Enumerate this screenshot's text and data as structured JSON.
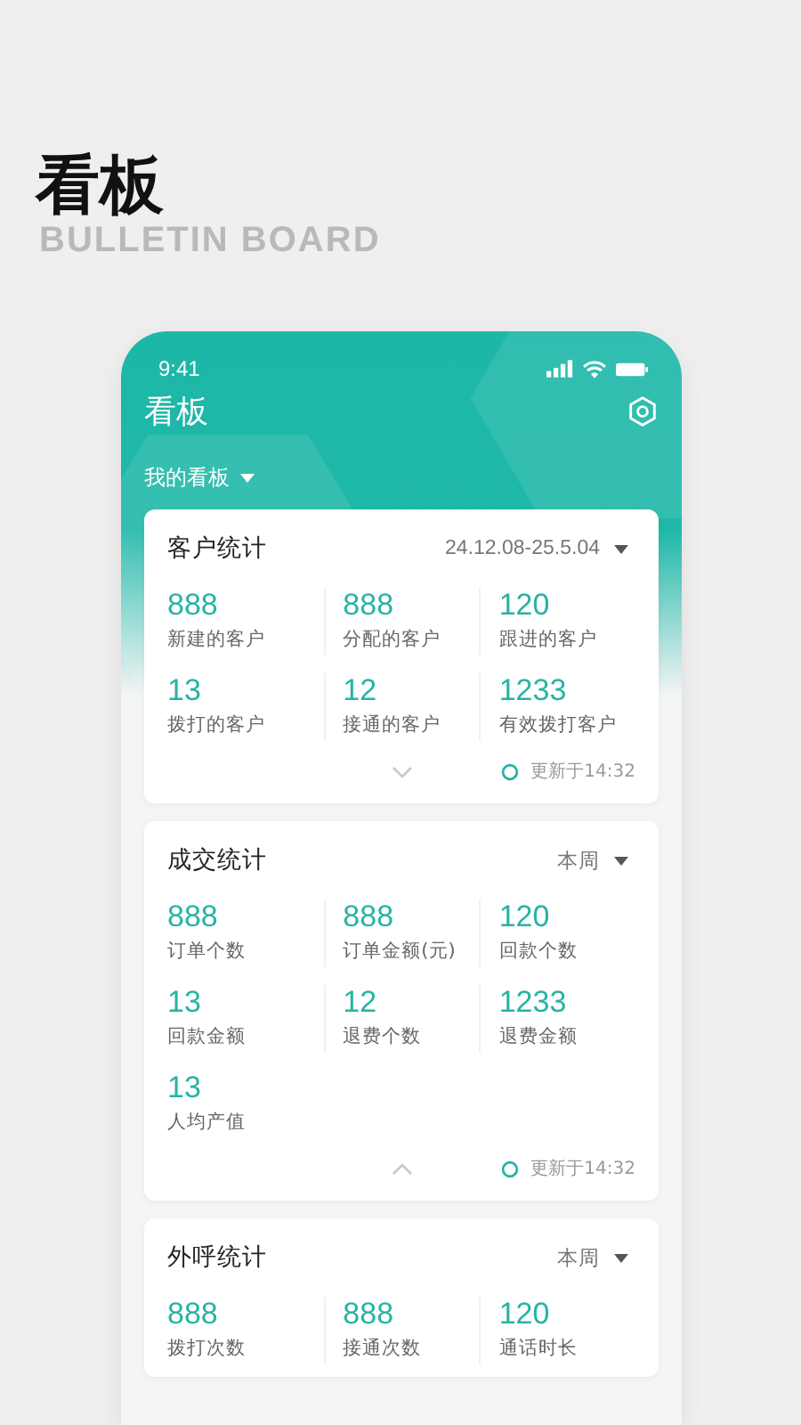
{
  "heading": {
    "title": "看板",
    "subtitle": "BULLETIN BOARD"
  },
  "phone": {
    "status_bar": {
      "time": "9:41"
    },
    "title": "看板",
    "board_selector": "我的看板",
    "cards": [
      {
        "title": "客户统计",
        "period": "24.12.08-25.5.04",
        "stats": [
          {
            "value": "888",
            "label": "新建的客户"
          },
          {
            "value": "888",
            "label": "分配的客户"
          },
          {
            "value": "120",
            "label": "跟进的客户"
          },
          {
            "value": "13",
            "label": "拨打的客户"
          },
          {
            "value": "12",
            "label": "接通的客户"
          },
          {
            "value": "1233",
            "label": "有效拨打客户"
          }
        ],
        "footer": {
          "expanded": false,
          "updated": "更新于14:32"
        }
      },
      {
        "title": "成交统计",
        "period": "本周",
        "stats": [
          {
            "value": "888",
            "label": "订单个数"
          },
          {
            "value": "888",
            "label": "订单金额(元)"
          },
          {
            "value": "120",
            "label": "回款个数"
          },
          {
            "value": "13",
            "label": "回款金额"
          },
          {
            "value": "12",
            "label": "退费个数"
          },
          {
            "value": "1233",
            "label": "退费金额"
          },
          {
            "value": "13",
            "label": "人均产值"
          }
        ],
        "footer": {
          "expanded": true,
          "updated": "更新于14:32"
        }
      },
      {
        "title": "外呼统计",
        "period": "本周",
        "stats": [
          {
            "value": "888",
            "label": "拨打次数"
          },
          {
            "value": "888",
            "label": "接通次数"
          },
          {
            "value": "120",
            "label": "通话时长"
          }
        ]
      }
    ]
  }
}
